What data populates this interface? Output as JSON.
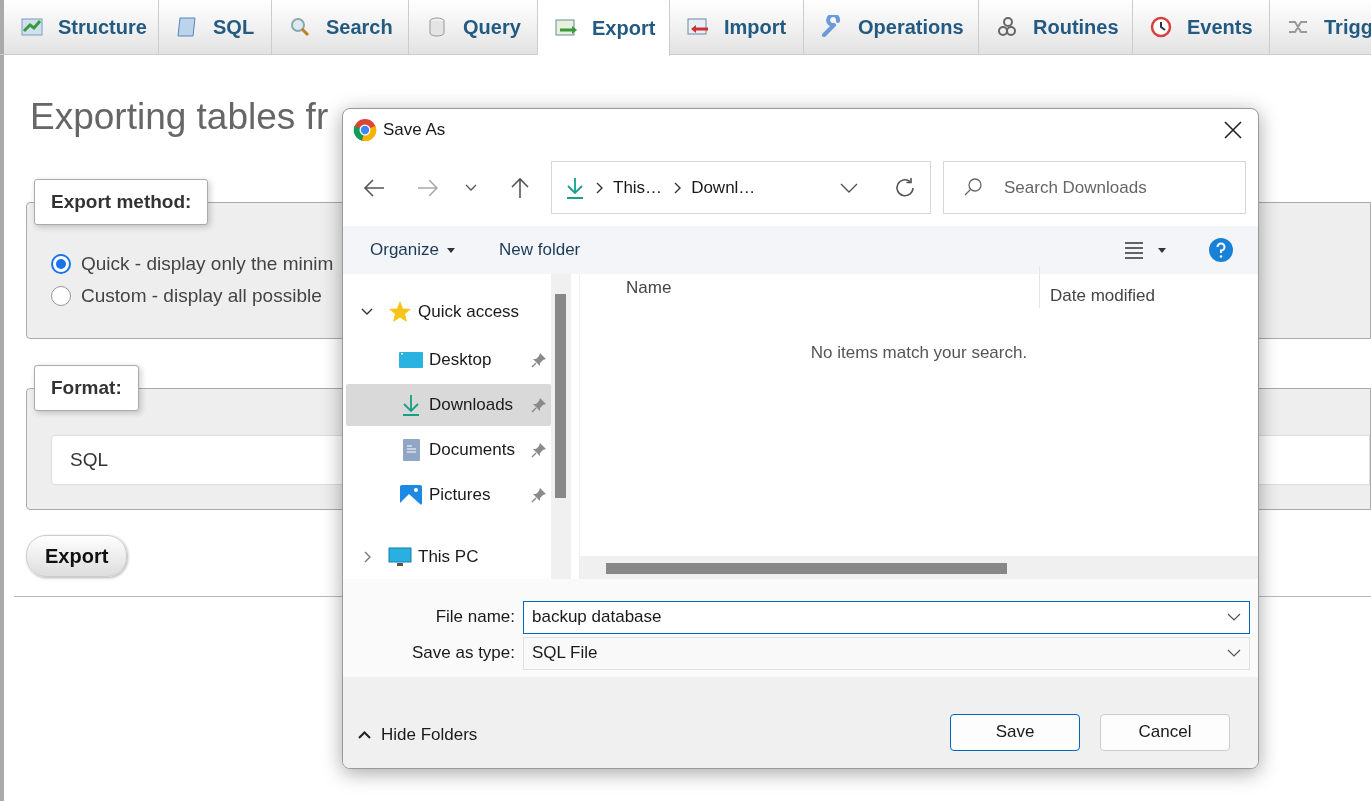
{
  "tabs": [
    {
      "label": "Structure",
      "selected": false
    },
    {
      "label": "SQL",
      "selected": false
    },
    {
      "label": "Search",
      "selected": false
    },
    {
      "label": "Query",
      "selected": false
    },
    {
      "label": "Export",
      "selected": true
    },
    {
      "label": "Import",
      "selected": false
    },
    {
      "label": "Operations",
      "selected": false
    },
    {
      "label": "Routines",
      "selected": false
    },
    {
      "label": "Events",
      "selected": false
    },
    {
      "label": "Trigg",
      "selected": false
    }
  ],
  "heading": "Exporting tables fr",
  "export_method": {
    "legend": "Export method:",
    "options": [
      {
        "label": "Quick - display only the minim",
        "selected": true
      },
      {
        "label": "Custom - display all possible",
        "selected": false
      }
    ]
  },
  "format": {
    "legend": "Format:",
    "value": "SQL"
  },
  "export_button": "Export",
  "dialog": {
    "title": "Save As",
    "breadcrumb": [
      "This…",
      "Downl…"
    ],
    "search": {
      "placeholder": "Search Downloads"
    },
    "toolbar": {
      "organize": "Organize",
      "new_folder": "New folder"
    },
    "nav": [
      {
        "label": "Quick access",
        "selected": false,
        "expanded": true,
        "children": [
          {
            "label": "Desktop",
            "selected": false,
            "pinned": true
          },
          {
            "label": "Downloads",
            "selected": true,
            "pinned": true
          },
          {
            "label": "Documents",
            "selected": false,
            "pinned": true
          },
          {
            "label": "Pictures",
            "selected": false,
            "pinned": true
          }
        ]
      },
      {
        "label": "This PC",
        "selected": false,
        "expanded": false
      }
    ],
    "columns": [
      "Name",
      "Date modified"
    ],
    "empty_message": "No items match your search.",
    "file_name": {
      "label": "File name:",
      "value": "backup database"
    },
    "save_as_type": {
      "label": "Save as type:",
      "value": "SQL File"
    },
    "hide_folders": "Hide Folders",
    "buttons": [
      {
        "label": "Save",
        "kind": "primary"
      },
      {
        "label": "Cancel",
        "kind": "secondary"
      }
    ]
  }
}
